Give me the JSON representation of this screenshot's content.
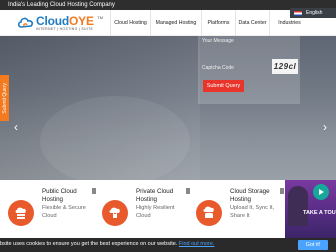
{
  "topbar": {
    "tagline": "India's Leading Cloud Hosting Company"
  },
  "language": {
    "selected": "English"
  },
  "logo": {
    "brand_part1": "Cloud",
    "brand_part2": "OYE",
    "subtext": "INTERNET | HOSTING | SUITE",
    "tm": "TM"
  },
  "nav": {
    "items": [
      {
        "label": "Cloud Hosting"
      },
      {
        "label": "Managed Hosting"
      },
      {
        "label": "Platforms"
      },
      {
        "label": "Data Center"
      },
      {
        "label": "Industries"
      }
    ]
  },
  "form": {
    "message_placeholder": "Your Message",
    "captcha_placeholder": "Captcha Code",
    "captcha_code": "129cl",
    "submit_label": "Submit Query"
  },
  "side_tab": {
    "label": "Submit Query"
  },
  "cards": [
    {
      "title": "Public Cloud Hosting",
      "desc": "Flexible & Secure Cloud"
    },
    {
      "title": "Private Cloud Hosting",
      "desc": "Highly Resilient Cloud"
    },
    {
      "title": "Cloud Storage Hosting",
      "desc": "Upload It, Sync It, Share It"
    }
  ],
  "video": {
    "label": "TAKE A TOU"
  },
  "cookie": {
    "text": "bsite uses cookies to ensure you get the best experience on our website.",
    "link": "Find out more.",
    "button": "Got it!"
  },
  "colors": {
    "accent_orange": "#f47a20",
    "brand_blue": "#1f7cc1",
    "submit_red": "#e8342a",
    "card_icon": "#e8592c",
    "cookie_bg": "#2a2a2a",
    "cookie_button": "#4aa3ff",
    "play_button": "#16a89a"
  }
}
